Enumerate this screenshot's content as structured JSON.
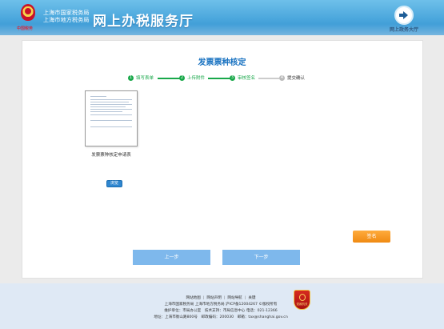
{
  "header": {
    "sub_brand": "中国税务",
    "bureau_line1": "上海市国家税务局",
    "bureau_line2": "上海市地方税务局",
    "title": "网上办税服务厅",
    "top_right_label": "网上政务大厅"
  },
  "main": {
    "title": "发票票种核定",
    "steps": [
      {
        "num": "1",
        "label": "填写表单",
        "status": "done"
      },
      {
        "num": "2",
        "label": "上传附件",
        "status": "done"
      },
      {
        "num": "3",
        "label": "审核签名",
        "status": "current"
      },
      {
        "num": "4",
        "label": "提交确认",
        "status": "pending"
      }
    ],
    "document_caption": "发票票种核定申请表",
    "browse_label": "浏览",
    "sign_label": "签名",
    "prev_label": "上一步",
    "next_label": "下一步"
  },
  "footer": {
    "links": [
      "网站地图",
      "网站声明",
      "网站导航",
      "关键"
    ],
    "line1": "上海市国家税务局 上海市地方税务局 沪ICP备12004267 ©版权所有",
    "line2": "维护单位：市局办公室　技术支持：市局信息中心 电话：021-12366",
    "line3": "地址：上海市衡山路800号　邮政编码：200030　邮箱：tax@shanghai.gov.cn",
    "badge_label": "党政机关"
  },
  "colors": {
    "header_blue": "#4aa6dc",
    "step_green": "#19a84a",
    "title_blue": "#1771c0",
    "sign_orange": "#f08a12",
    "nav_button_blue": "#7eb8ec"
  }
}
